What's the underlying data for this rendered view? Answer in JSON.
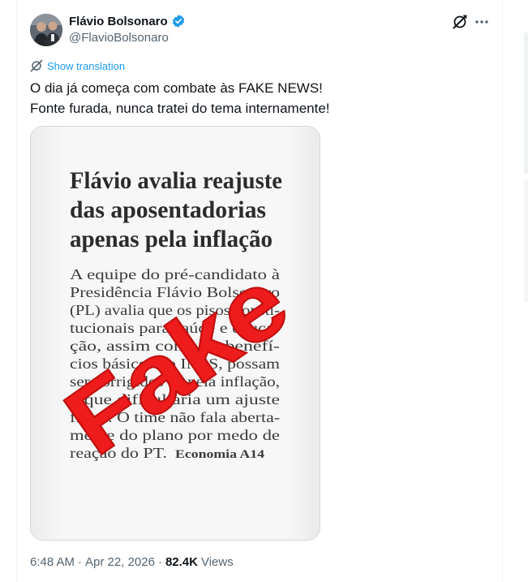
{
  "author": {
    "display_name": "Flávio Bolsonaro",
    "handle": "@FlavioBolsonaro",
    "verified": true,
    "avatar_icon": "avatar"
  },
  "actions": {
    "grok_icon": "grok-icon",
    "more_icon": "more-icon"
  },
  "translate": {
    "label": "Show translation",
    "icon": "translate-icon"
  },
  "tweet": {
    "lines": [
      "O dia já começa com combate às FAKE NEWS!",
      "Fonte furada, nunca tratei do tema internamente!"
    ]
  },
  "media": {
    "headline": [
      "Flávio avalia reajuste",
      "das aposentadorias",
      "apenas pela inflação"
    ],
    "body_lines": [
      "A equipe do pré-candidato à",
      "Presidência Flávio Bolsonaro",
      "(PL) avalia que os pisos consti-",
      "tucionais para saúde e educa-",
      "ção, assim como os benefí-",
      "cios básicos do INSS, possam",
      "ser corrigidos só pela inflação,",
      "o que dificultaria um ajuste",
      "fiscal. O time não fala aberta-",
      "mente do plano por medo de",
      "reação do PT."
    ],
    "section_ref": "Economia A14",
    "stamp": "Fake"
  },
  "meta": {
    "time": "6:48 AM",
    "separator": "·",
    "date": "Apr 22, 2026",
    "views_count": "82.4K",
    "views_label": "Views"
  },
  "colors": {
    "accent": "#1d9bf0",
    "secondary_text": "#536471",
    "stamp_red": "#ee1c1c"
  }
}
